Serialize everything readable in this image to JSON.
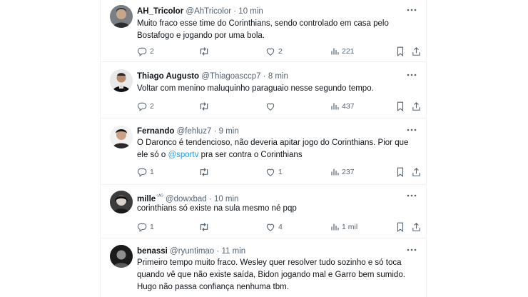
{
  "tweets": [
    {
      "name": "AH_Tricolor",
      "handle": "@AhTricolor",
      "sep": "·",
      "time": "10 min",
      "badge": "",
      "body_parts": [
        "Muito fraco esse time do Corinthians, sendo controlado em casa pelo Bostafogo e jogando por uma bola."
      ],
      "mention": "",
      "body_after": "",
      "replies": "2",
      "retweets": "",
      "likes": "2",
      "views": "221"
    },
    {
      "name": "Thiago Augusto",
      "handle": "@Thiagoasccp7",
      "sep": "·",
      "time": "8 min",
      "badge": "",
      "body_parts": [
        "Voltar com menino maluquinho paraguaio nesse segundo tempo."
      ],
      "mention": "",
      "body_after": "",
      "replies": "2",
      "retweets": "",
      "likes": "",
      "views": "437"
    },
    {
      "name": "Fernando",
      "handle": "@fehluz7",
      "sep": "·",
      "time": "9 min",
      "badge": "",
      "body_parts": [
        "O Daronco é tendencioso, não deveria apitar jogo do Corinthians. Pior que ele só o "
      ],
      "mention": "@sportv",
      "body_after": " pra ser contra o Corinthians",
      "replies": "1",
      "retweets": "",
      "likes": "1",
      "views": "237"
    },
    {
      "name": "mille",
      "handle": "@dowxbad",
      "sep": "·",
      "time": "10 min",
      "badge": "⁵ᴬᴳ",
      "body_parts": [
        "corinthians só existe na sula mesmo né pqp"
      ],
      "mention": "",
      "body_after": "",
      "replies": "1",
      "retweets": "",
      "likes": "4",
      "views": "1 mil"
    },
    {
      "name": "benassi",
      "handle": "@ryuntimao",
      "sep": "·",
      "time": "11 min",
      "badge": "",
      "body_parts": [
        "Primeiro tempo muito fraco. Wesley quer resolver tudo sozinho e só toca quando vê que não existe saída, Bidon jogando mal e Garro bem sumido. Hugo não passa confiança nenhuma tbm."
      ],
      "mention": "",
      "body_after": "",
      "replies": "",
      "retweets": "",
      "likes": "",
      "views": ""
    }
  ],
  "icons": {
    "more": "more-dots-icon",
    "reply": "reply-icon",
    "retweet": "retweet-icon",
    "like": "like-icon",
    "views": "views-icon",
    "bookmark": "bookmark-icon",
    "share": "share-icon"
  },
  "colors": {
    "text": "#0f1419",
    "secondary": "#536471",
    "mention": "#1d9bf0",
    "divider": "#eff3f4"
  }
}
